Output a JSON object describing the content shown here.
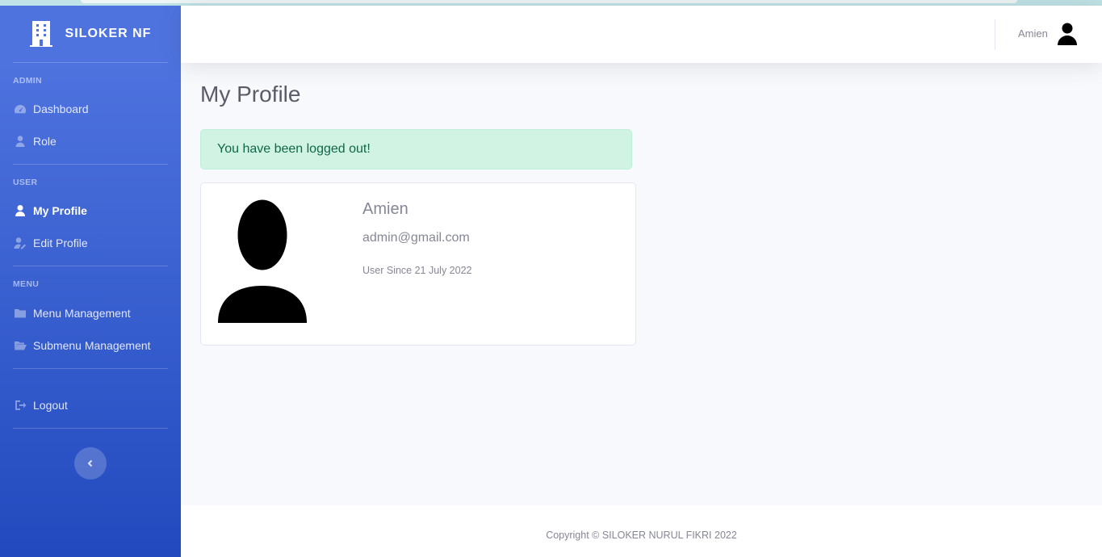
{
  "brand": {
    "name": "SILOKER NF",
    "icon": "building-icon"
  },
  "sidebar": {
    "sections": [
      {
        "heading": "ADMIN",
        "items": [
          {
            "label": "Dashboard",
            "icon": "tachometer-icon"
          },
          {
            "label": "Role",
            "icon": "user-tie-icon"
          }
        ]
      },
      {
        "heading": "USER",
        "items": [
          {
            "label": "My Profile",
            "icon": "user-icon",
            "active": true
          },
          {
            "label": "Edit Profile",
            "icon": "user-edit-icon"
          }
        ]
      },
      {
        "heading": "MENU",
        "items": [
          {
            "label": "Menu Management",
            "icon": "folder-icon"
          },
          {
            "label": "Submenu Management",
            "icon": "folder-open-icon"
          }
        ]
      }
    ],
    "logout": {
      "label": "Logout",
      "icon": "sign-out-icon"
    },
    "toggle_icon": "chevron-left-icon"
  },
  "topbar": {
    "user_name": "Amien",
    "avatar_icon": "user-icon"
  },
  "page": {
    "title": "My Profile"
  },
  "alert": {
    "message": "You have been logged out!",
    "color": "#d0f3e4"
  },
  "profile": {
    "name": "Amien",
    "email": "admin@gmail.com",
    "since": "User Since 21 July 2022"
  },
  "footer": {
    "text": "Copyright © SILOKER NURUL FIKRI 2022"
  },
  "colors": {
    "sidebar_start": "#4e73df",
    "sidebar_end": "#224abe",
    "background": "#f8f9fc"
  }
}
